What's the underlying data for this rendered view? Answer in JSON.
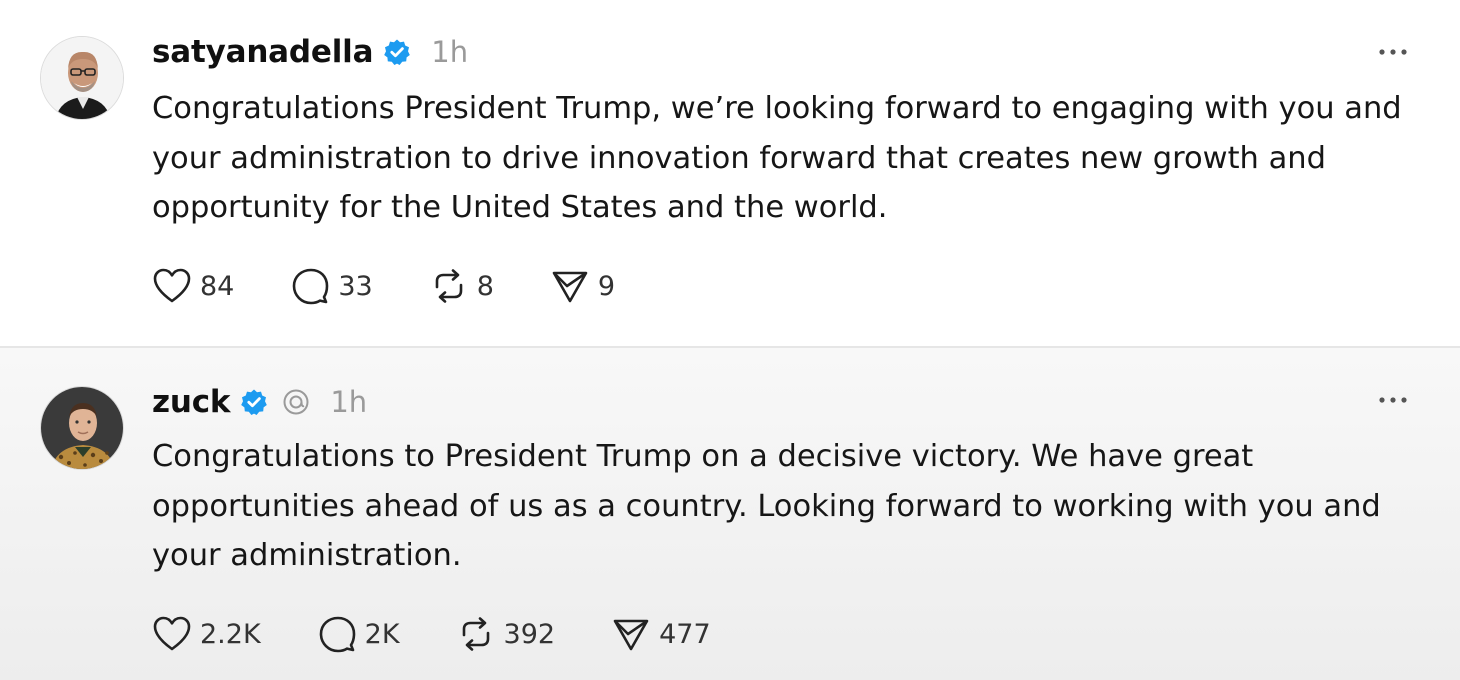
{
  "posts": [
    {
      "username": "satyanadella",
      "verified": true,
      "time": "1h",
      "text": "Congratulations President Trump, we’re looking forward to engaging with you and your administration to drive innovation forward that creates new growth and opportunity for the United States and the world.",
      "likes": "84",
      "replies": "33",
      "reposts": "8",
      "shares": "9"
    },
    {
      "username": "zuck",
      "verified": true,
      "time": "1h",
      "text": "Congratulations to President Trump on a decisive victory. We have great opportunities ahead of us as a country. Looking forward to working with you and your administration.",
      "likes": "2.2K",
      "replies": "2K",
      "reposts": "392",
      "shares": "477"
    }
  ],
  "colors": {
    "verified": "#1d9bf0",
    "muted": "#9a9a9a",
    "text": "#161616"
  },
  "icons": [
    "verified-badge-icon",
    "threads-icon",
    "more-icon",
    "heart-icon",
    "reply-icon",
    "repost-icon",
    "share-icon"
  ]
}
